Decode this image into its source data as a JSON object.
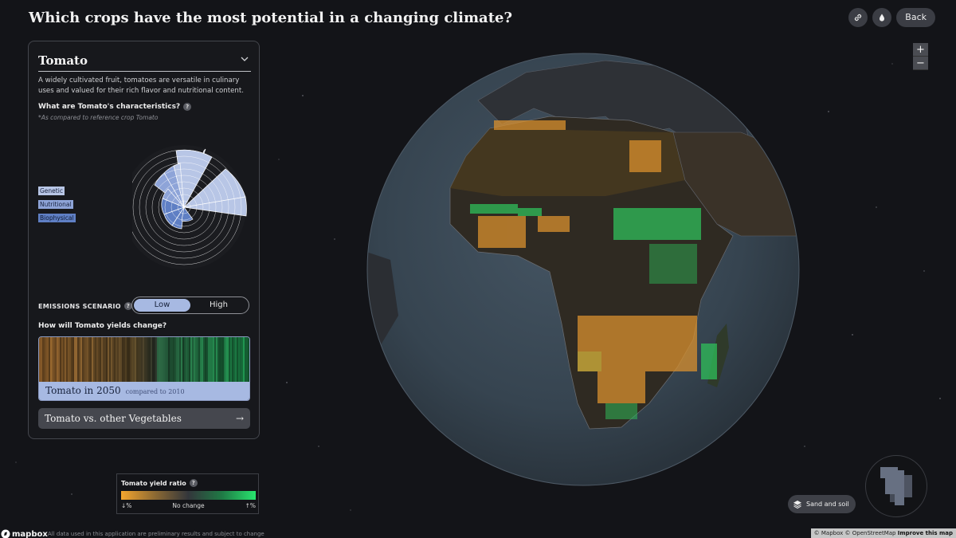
{
  "header": {
    "title": "Which crops have the most potential in a changing climate?",
    "back_label": "Back",
    "link_icon": "link-icon",
    "water_icon": "water-drop-icon"
  },
  "zoom": {
    "in": "+",
    "out": "−"
  },
  "panel": {
    "crop_name": "Tomato",
    "description": "A widely cultivated fruit, tomatoes are versatile in culinary uses and valued for their rich flavor and nutritional content.",
    "characteristics_question": "What are Tomato's characteristics?",
    "help_glyph": "?",
    "reference_note": "*As compared to reference crop Tomato",
    "legend_tags": [
      "Genetic",
      "Nutritional",
      "Biophysical"
    ],
    "emissions_label": "EMISSIONS SCENARIO",
    "scenario_low": "Low",
    "scenario_high": "High",
    "selected_scenario": "Low",
    "yield_question": "How will Tomato yields change?",
    "yield_title": "Tomato in 2050",
    "yield_subtitle": "compared to 2010",
    "compare_label": "Tomato vs. other Vegetables",
    "compare_arrow": "→"
  },
  "map_legend": {
    "title": "Tomato yield ratio",
    "low_label": "↓%",
    "mid_label": "No change",
    "high_label": "↑%",
    "colors": {
      "decrease": "#f4a52e",
      "neutral": "#33363b",
      "increase": "#28e46e"
    }
  },
  "layers_button": {
    "label": "Sand and soil",
    "icon": "layers-icon"
  },
  "footer": {
    "brand": "mapbox",
    "disclaimer": "All data used in this application are preliminary results and subject to change",
    "attribution": "© Mapbox © OpenStreetMap",
    "improve": "Improve this map"
  }
}
